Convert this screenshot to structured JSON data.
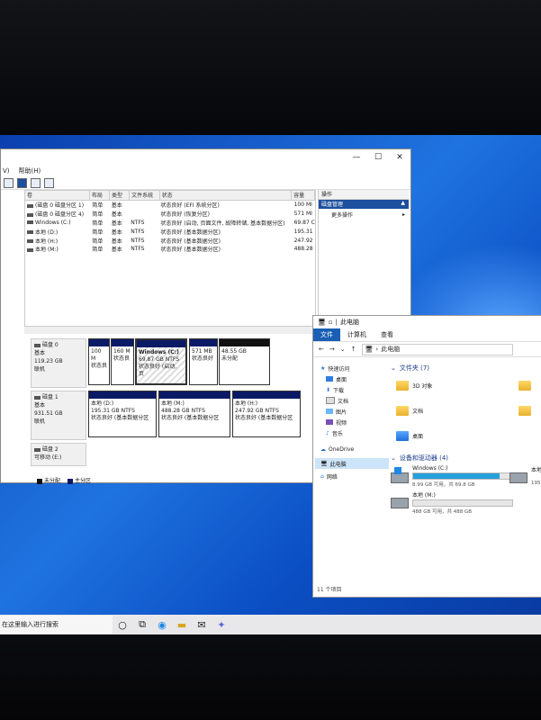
{
  "disk_mgmt": {
    "menu": [
      "V)",
      "帮助(H)"
    ],
    "columns": [
      "卷",
      "布局",
      "类型",
      "文件系统",
      "状态",
      "容量"
    ],
    "volumes": [
      {
        "name": "(磁盘 0 磁盘分区 1)",
        "layout": "简单",
        "type": "基本",
        "fs": "",
        "status": "状态良好 (EFI 系统分区)",
        "cap": "100 MI"
      },
      {
        "name": "(磁盘 0 磁盘分区 4)",
        "layout": "简单",
        "type": "基本",
        "fs": "",
        "status": "状态良好 (恢复分区)",
        "cap": "571 MI"
      },
      {
        "name": "Windows (C:)",
        "layout": "简单",
        "type": "基本",
        "fs": "NTFS",
        "status": "状态良好 (启动, 页面文件, 故障转储, 基本数据分区)",
        "cap": "69.87 C"
      },
      {
        "name": "本地 (D:)",
        "layout": "简单",
        "type": "基本",
        "fs": "NTFS",
        "status": "状态良好 (基本数据分区)",
        "cap": "195.31"
      },
      {
        "name": "本地 (H:)",
        "layout": "简单",
        "type": "基本",
        "fs": "NTFS",
        "status": "状态良好 (基本数据分区)",
        "cap": "247.92"
      },
      {
        "name": "本地 (M:)",
        "layout": "简单",
        "type": "基本",
        "fs": "NTFS",
        "status": "状态良好 (基本数据分区)",
        "cap": "488.28"
      }
    ],
    "actions_header": "操作",
    "actions_selected": "磁盘管理",
    "actions_more": "更多操作",
    "disk0": {
      "title": "磁盘 0",
      "type": "基本",
      "size": "119.23 GB",
      "status": "联机",
      "parts": [
        {
          "l1": "100 M",
          "l2": "状态良"
        },
        {
          "l1": "160 M",
          "l2": "状态良"
        },
        {
          "l1": "Windows (C:)",
          "l2": "69.87 GB NTFS",
          "l3": "状态良好 (启动, 页"
        },
        {
          "l1": "571 MB",
          "l2": "状态良好"
        },
        {
          "l1": "48.55 GB",
          "l2": "未分配"
        }
      ]
    },
    "disk1": {
      "title": "磁盘 1",
      "type": "基本",
      "size": "931.51 GB",
      "status": "联机",
      "parts": [
        {
          "l1": "本地 (D:)",
          "l2": "195.31 GB NTFS",
          "l3": "状态良好 (基本数据分区"
        },
        {
          "l1": "本地 (M:)",
          "l2": "488.28 GB NTFS",
          "l3": "状态良好 (基本数据分区"
        },
        {
          "l1": "本地 (H:)",
          "l2": "247.92 GB NTFS",
          "l3": "状态良好 (基本数据分区"
        }
      ]
    },
    "disk2": {
      "title": "磁盘 2",
      "type": "可移动 (E:)"
    },
    "legend": [
      "未分配",
      "主分区"
    ]
  },
  "explorer": {
    "title": "此电脑",
    "tabs": [
      "文件",
      "计算机",
      "查看"
    ],
    "address": "此电脑",
    "sidebar": [
      "快速访问",
      "桌面",
      "下载",
      "文档",
      "图片",
      "视频",
      "音乐",
      "OneDrive",
      "此电脑",
      "网络"
    ],
    "folders_header": "文件夹 (7)",
    "folders": [
      "3D 对象",
      "文档",
      "桌面"
    ],
    "devices_header": "设备和驱动器 (4)",
    "drives": [
      {
        "name": "Windows (C:)",
        "space": "8.99 GB 可用，共 69.8 GB",
        "used": 0.87
      },
      {
        "name": "本地 (M:)",
        "space": "488 GB 可用，共 488 GB",
        "used": 0.0
      }
    ],
    "partial_drive": "本地",
    "partial_size": "195",
    "status": "11 个项目"
  },
  "taskbar": {
    "search_text": "在这里输入进行搜索"
  }
}
